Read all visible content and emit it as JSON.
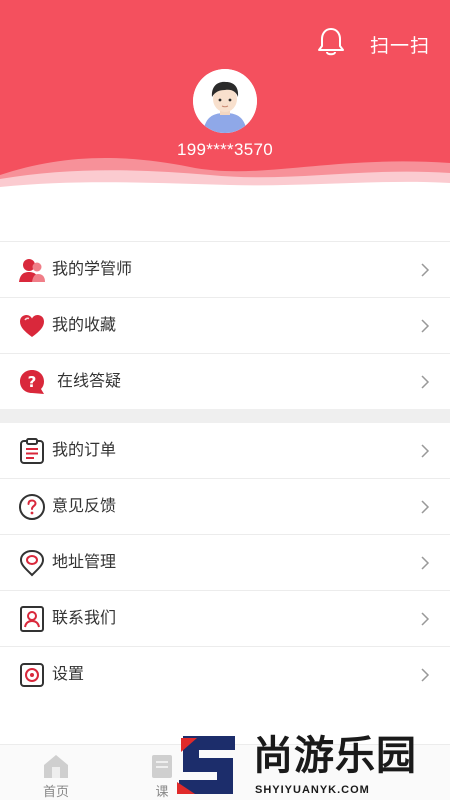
{
  "colors": {
    "accent": "#f4505e",
    "icon_red": "#d9283b",
    "text": "#333333",
    "separator": "#efefef"
  },
  "header": {
    "scan_label": "扫一扫",
    "phone": "199****3570",
    "icons": {
      "bell": "bell-icon",
      "avatar": "avatar-image"
    }
  },
  "menu_group_1": [
    {
      "label": "我的学管师",
      "icon": "advisor-icon"
    },
    {
      "label": "我的收藏",
      "icon": "heart-icon"
    },
    {
      "label": " 在线答疑",
      "icon": "question-bubble-icon"
    }
  ],
  "menu_group_2": [
    {
      "label": "我的订单",
      "icon": "clipboard-icon"
    },
    {
      "label": "意见反馈",
      "icon": "feedback-question-icon"
    },
    {
      "label": "地址管理",
      "icon": "location-pin-icon"
    },
    {
      "label": "联系我们",
      "icon": "contact-card-icon"
    },
    {
      "label": "设置",
      "icon": "gear-icon"
    }
  ],
  "tabbar": [
    {
      "label": "首页",
      "icon": "home-icon"
    },
    {
      "label": "课",
      "icon": "course-icon"
    }
  ],
  "watermark": {
    "name": "尚游乐园",
    "domain": "SHYIYUANYK.COM"
  }
}
